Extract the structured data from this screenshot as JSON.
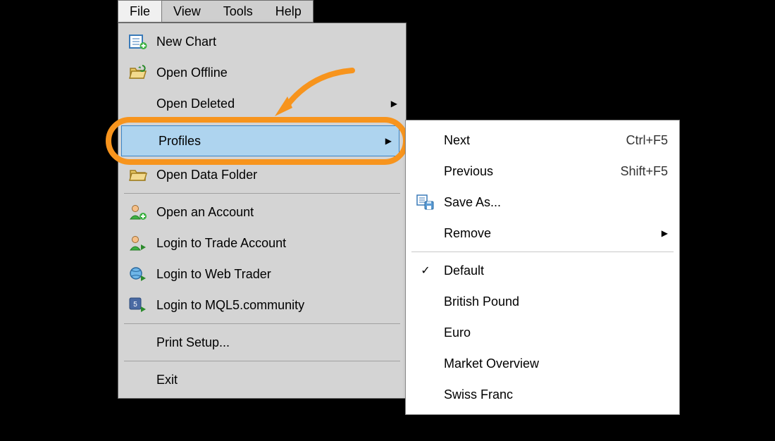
{
  "menubar": {
    "file": "File",
    "view": "View",
    "tools": "Tools",
    "help": "Help"
  },
  "file_menu": {
    "new_chart": "New Chart",
    "open_offline": "Open Offline",
    "open_deleted": "Open Deleted",
    "profiles": "Profiles",
    "open_data_folder": "Open Data Folder",
    "open_account": "Open an Account",
    "login_trade": "Login to Trade Account",
    "login_web": "Login to Web Trader",
    "login_mql5": "Login to MQL5.community",
    "print_setup": "Print Setup...",
    "exit": "Exit"
  },
  "profiles_submenu": {
    "next": {
      "label": "Next",
      "shortcut": "Ctrl+F5"
    },
    "previous": {
      "label": "Previous",
      "shortcut": "Shift+F5"
    },
    "save_as": "Save As...",
    "remove": "Remove",
    "profiles": {
      "default": "Default",
      "british_pound": "British Pound",
      "euro": "Euro",
      "market_overview": "Market Overview",
      "swiss_franc": "Swiss Franc"
    }
  }
}
